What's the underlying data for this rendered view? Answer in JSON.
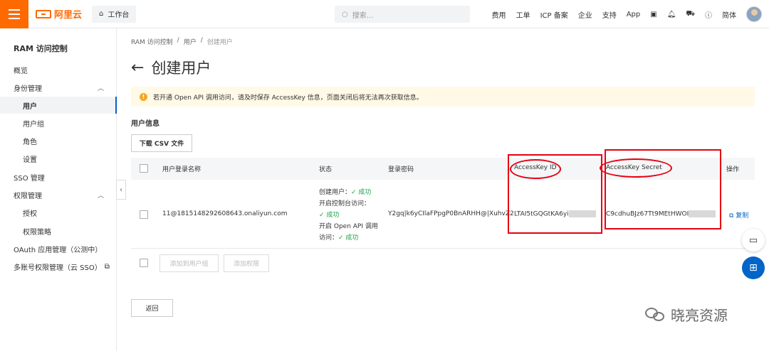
{
  "topbar": {
    "brand": "阿里云",
    "workbench_label": "工作台",
    "search_placeholder": "搜索...",
    "nav": [
      "费用",
      "工单",
      "ICP 备案",
      "企业",
      "支持",
      "App"
    ],
    "lang": "简体"
  },
  "sidebar": {
    "title": "RAM 访问控制",
    "items": [
      {
        "label": "概览"
      },
      {
        "label": "身份管理",
        "expanded": true
      },
      {
        "label": "用户",
        "active": true
      },
      {
        "label": "用户组"
      },
      {
        "label": "角色"
      },
      {
        "label": "设置"
      },
      {
        "label": "SSO 管理"
      },
      {
        "label": "权限管理",
        "expanded": true
      },
      {
        "label": "授权"
      },
      {
        "label": "权限策略"
      },
      {
        "label": "OAuth 应用管理（公测中）"
      },
      {
        "label": "多账号权限管理（云 SSO）"
      }
    ]
  },
  "breadcrumb": [
    "RAM 访问控制",
    "/",
    "用户",
    "/",
    "创建用户"
  ],
  "page": {
    "title": "创建用户",
    "notice": "若开通 Open API 调用访问，请及时保存 AccessKey 信息，页面关闭后将无法再次获取信息。",
    "section_title": "用户信息",
    "csv_button": "下载 CSV 文件",
    "back_button": "返回"
  },
  "table": {
    "headers": [
      "用户登录名称",
      "状态",
      "登录密码",
      "AccessKey ID",
      "AccessKey Secret",
      "操作"
    ],
    "rows": [
      {
        "login_name": "11@1815148292608643.onaliyun.com",
        "status": [
          "创建用户：",
          "✓ 成功",
          "开启控制台访问：",
          "✓ 成功",
          "开启 Open API 调用",
          "访问：",
          "✓ 成功"
        ],
        "password": "Y2gq|k6yCIlaFPpgP0BnARHH@|XuhvZ2",
        "access_key_id": "LTAI5tGQGtKA6yi",
        "access_key_secret": "C9cdhuBJz67Tt9MEtHWOI",
        "action": "复制"
      }
    ],
    "footer_buttons": [
      "添加到用户组",
      "添加权限"
    ]
  },
  "watermark": "晓亮资源",
  "colors": {
    "brand": "#ff6a00",
    "link": "#0064c8",
    "annotation": "#e60012",
    "success": "#1aa34a"
  }
}
